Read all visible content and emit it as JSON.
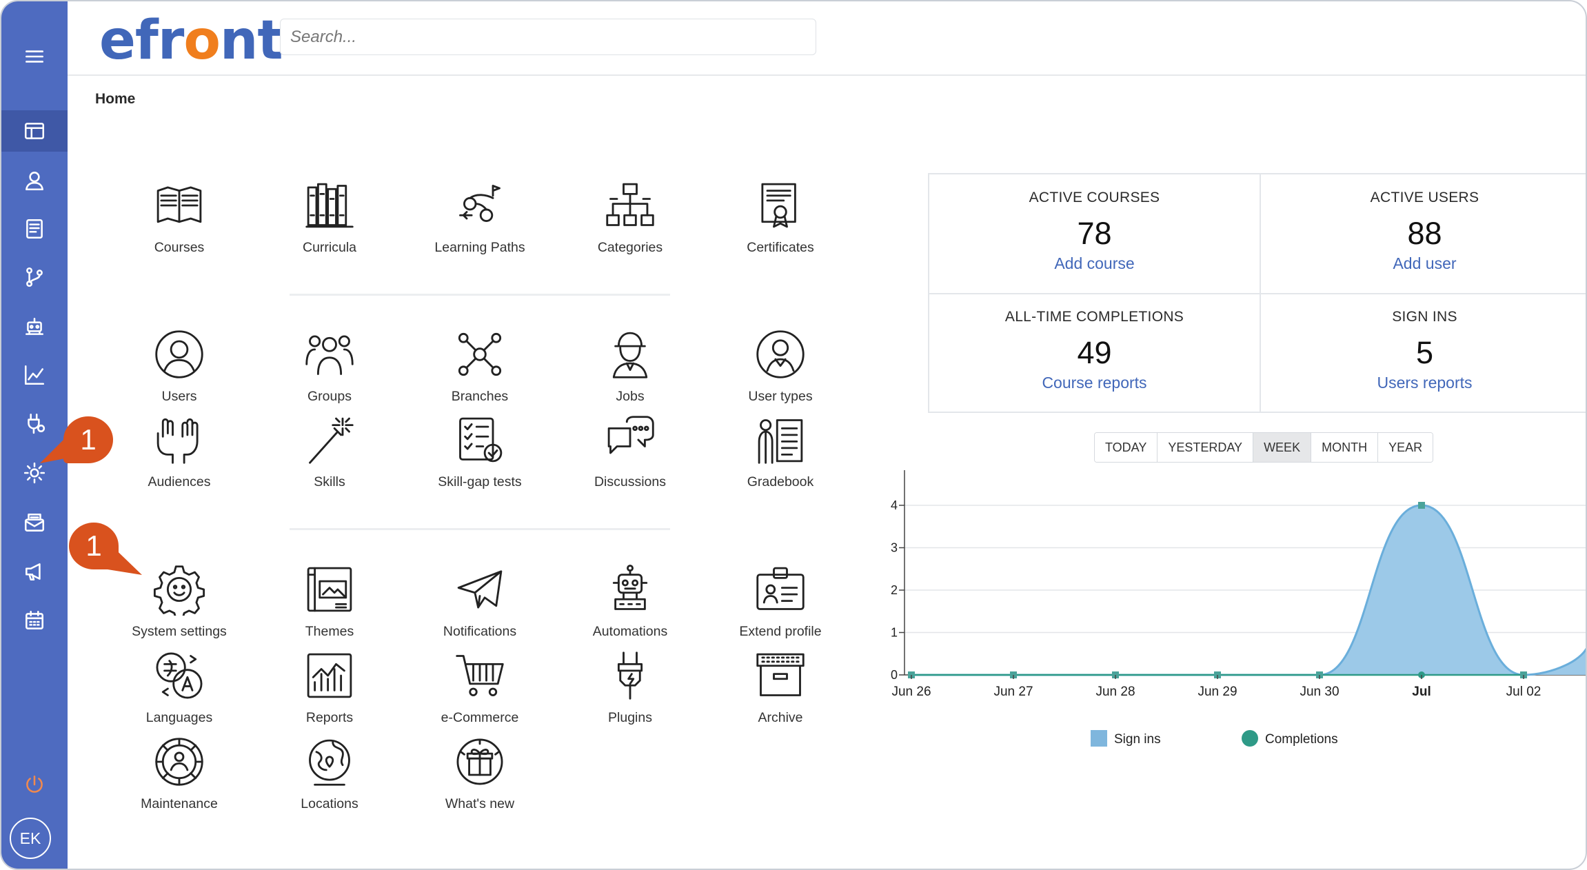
{
  "app": {
    "logo_prefix": "efr",
    "logo_o": "o",
    "logo_suffix": "nt"
  },
  "search": {
    "placeholder": "Search..."
  },
  "breadcrumb": "Home",
  "sidebar": {
    "items": [
      {
        "icon": "menu-icon"
      },
      {
        "icon": "dashboard-icon",
        "active": true
      },
      {
        "icon": "user-icon"
      },
      {
        "icon": "courses-icon"
      },
      {
        "icon": "branches-icon"
      },
      {
        "icon": "automations-icon"
      },
      {
        "icon": "reports-icon"
      },
      {
        "icon": "plugins-icon"
      },
      {
        "icon": "settings-icon"
      },
      {
        "icon": "messages-icon"
      },
      {
        "icon": "announcements-icon"
      },
      {
        "icon": "calendar-icon"
      }
    ],
    "power_icon": "power-icon",
    "avatar": "EK"
  },
  "tiles": [
    {
      "label": "Courses",
      "icon": "courses"
    },
    {
      "label": "Curricula",
      "icon": "curricula"
    },
    {
      "label": "Learning Paths",
      "icon": "learning-paths"
    },
    {
      "label": "Categories",
      "icon": "categories"
    },
    {
      "label": "Certificates",
      "icon": "certificates"
    },
    {
      "label": "Users",
      "icon": "users"
    },
    {
      "label": "Groups",
      "icon": "groups"
    },
    {
      "label": "Branches",
      "icon": "branches"
    },
    {
      "label": "Jobs",
      "icon": "jobs"
    },
    {
      "label": "User types",
      "icon": "user-types"
    },
    {
      "label": "Audiences",
      "icon": "audiences"
    },
    {
      "label": "Skills",
      "icon": "skills"
    },
    {
      "label": "Skill-gap tests",
      "icon": "skill-gap-tests"
    },
    {
      "label": "Discussions",
      "icon": "discussions"
    },
    {
      "label": "Gradebook",
      "icon": "gradebook"
    },
    {
      "label": "System settings",
      "icon": "system-settings"
    },
    {
      "label": "Themes",
      "icon": "themes"
    },
    {
      "label": "Notifications",
      "icon": "notifications"
    },
    {
      "label": "Automations",
      "icon": "automations"
    },
    {
      "label": "Extend profile",
      "icon": "extend-profile"
    },
    {
      "label": "Languages",
      "icon": "languages"
    },
    {
      "label": "Reports",
      "icon": "reports"
    },
    {
      "label": "e-Commerce",
      "icon": "e-commerce"
    },
    {
      "label": "Plugins",
      "icon": "plugins"
    },
    {
      "label": "Archive",
      "icon": "archive"
    },
    {
      "label": "Maintenance",
      "icon": "maintenance"
    },
    {
      "label": "Locations",
      "icon": "locations"
    },
    {
      "label": "What's new",
      "icon": "whats-new"
    }
  ],
  "stats": [
    {
      "title": "ACTIVE COURSES",
      "value": "78",
      "action": "Add course"
    },
    {
      "title": "ACTIVE USERS",
      "value": "88",
      "action": "Add user"
    },
    {
      "title": "ALL-TIME COMPLETIONS",
      "value": "49",
      "action": "Course reports"
    },
    {
      "title": "SIGN INS",
      "value": "5",
      "action": "Users reports"
    }
  ],
  "period_tabs": [
    {
      "label": "TODAY"
    },
    {
      "label": "YESTERDAY"
    },
    {
      "label": "WEEK",
      "selected": true
    },
    {
      "label": "MONTH"
    },
    {
      "label": "YEAR"
    }
  ],
  "callouts": [
    "1",
    "1"
  ],
  "colors": {
    "sidebar": "#4e6bc0",
    "accent": "#4167b9",
    "logo_o": "#f07e1d",
    "callout": "#d9521e",
    "signins": "#7fb6dd",
    "completions": "#2e9a87"
  },
  "chart_data": {
    "type": "area",
    "x": [
      "Jun 26",
      "Jun 27",
      "Jun 28",
      "Jun 29",
      "Jun 30",
      "Jul",
      "Jul 02"
    ],
    "bold_ticks": [
      "Jul"
    ],
    "ylim": [
      0,
      5
    ],
    "yticks": [
      0,
      1,
      2,
      3,
      4,
      5
    ],
    "grid": true,
    "legend_position": "bottom",
    "series": [
      {
        "name": "Sign ins",
        "values": [
          0,
          0,
          0,
          0,
          0,
          4,
          0
        ]
      },
      {
        "name": "Completions",
        "values": [
          0,
          0,
          0,
          0,
          0,
          0,
          0
        ]
      }
    ]
  }
}
